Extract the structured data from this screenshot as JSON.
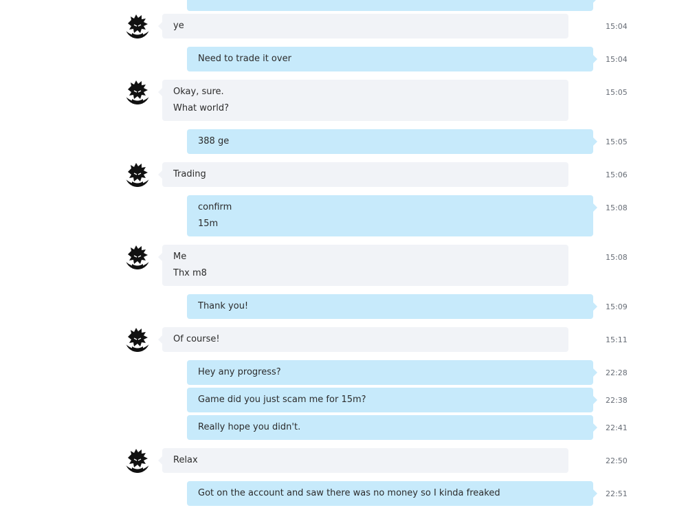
{
  "messages": [
    {
      "side": "out",
      "lines": [
        ""
      ],
      "time": ""
    },
    {
      "side": "in",
      "lines": [
        "ye"
      ],
      "time": "15:04"
    },
    {
      "side": "out",
      "lines": [
        "Need to trade it over"
      ],
      "time": "15:04"
    },
    {
      "side": "in",
      "lines": [
        "Okay, sure.",
        "What world?"
      ],
      "time": "15:05"
    },
    {
      "side": "out",
      "lines": [
        "388 ge"
      ],
      "time": "15:05"
    },
    {
      "side": "in",
      "lines": [
        "Trading"
      ],
      "time": "15:06"
    },
    {
      "side": "out",
      "lines": [
        "confirm",
        "15m"
      ],
      "time": "15:08"
    },
    {
      "side": "in",
      "lines": [
        "Me",
        "Thx m8"
      ],
      "time": "15:08"
    },
    {
      "side": "out",
      "lines": [
        "Thank you!"
      ],
      "time": "15:09"
    },
    {
      "side": "in",
      "lines": [
        "Of course!"
      ],
      "time": "15:11"
    },
    {
      "side": "out",
      "lines": [
        "Hey any progress?"
      ],
      "time": "22:28"
    },
    {
      "side": "out",
      "lines": [
        "Game did you just scam me for 15m?"
      ],
      "time": "22:38"
    },
    {
      "side": "out",
      "lines": [
        "Really hope you didn't."
      ],
      "time": "22:41"
    },
    {
      "side": "in",
      "lines": [
        "Relax"
      ],
      "time": "22:50"
    },
    {
      "side": "out",
      "lines": [
        "Got on the account and saw there was no money so I kinda freaked"
      ],
      "time": "22:51"
    }
  ],
  "colors": {
    "incoming_bubble": "#f1f3f7",
    "outgoing_bubble": "#c7eafb",
    "timestamp": "#666c75"
  },
  "icons": {
    "incoming_avatar": "avatar-icon"
  }
}
